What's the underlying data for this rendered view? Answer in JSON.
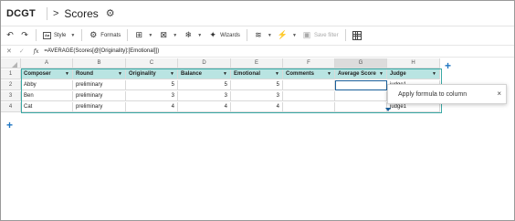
{
  "app": {
    "name": "DCGT",
    "breadcrumb_arrow": ">",
    "doc_title": "Scores"
  },
  "toolbar": {
    "undo_icon": "undo-icon",
    "redo_icon": "redo-icon",
    "style_label": "Style",
    "formats_label": "Formats",
    "wizards_label": "Wizards",
    "save_filter_label": "Save filter"
  },
  "formula_bar": {
    "cancel": "✕",
    "confirm": "✓",
    "fx": "fx",
    "formula": "=AVERAGE(Scores[@[Originality]:[Emotional]])"
  },
  "grid": {
    "columns": [
      "A",
      "B",
      "C",
      "D",
      "E",
      "F",
      "G",
      "H"
    ],
    "row_numbers": [
      "1",
      "2",
      "3",
      "4"
    ],
    "headers": [
      "Composer",
      "Round",
      "Originality",
      "Balance",
      "Emotional",
      "Comments",
      "Average Score",
      "Judge"
    ],
    "rows": [
      [
        "Abby",
        "preliminary",
        "5",
        "5",
        "5",
        "",
        "",
        "judge1"
      ],
      [
        "Ben",
        "preliminary",
        "3",
        "3",
        "3",
        "",
        "",
        "judge1"
      ],
      [
        "Cat",
        "preliminary",
        "4",
        "4",
        "4",
        "",
        "",
        "judge1"
      ]
    ]
  },
  "popup": {
    "text": "Apply formula to column",
    "close": "×"
  },
  "colors": {
    "table_header": "#b9e4e2",
    "table_border": "#3aa9a5",
    "accent": "#1f76c2"
  }
}
